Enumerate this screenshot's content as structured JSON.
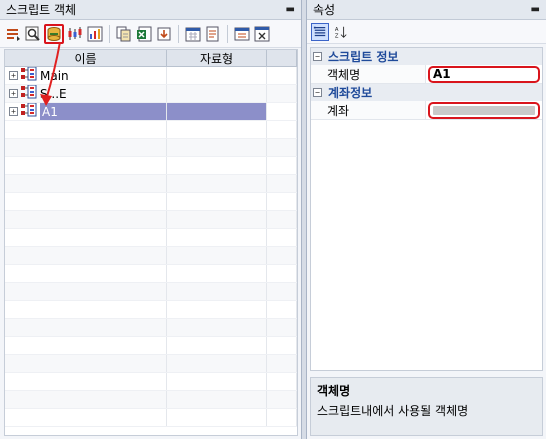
{
  "script_panel": {
    "title": "스크립트 객체",
    "pin": "ᚚ",
    "columns": [
      "이름",
      "자료형"
    ],
    "rows": [
      {
        "name": "Main",
        "type": ""
      },
      {
        "name": "S...E",
        "type": ""
      },
      {
        "name": "A1",
        "type": "",
        "selected": true
      }
    ]
  },
  "toolbar_icons": [
    "open-icon",
    "search-icon",
    "add-object-icon",
    "candles-icon",
    "chart-export-icon",
    "copy-icon",
    "excel-icon",
    "import-icon",
    "calendar-icon",
    "refresh-icon",
    "grid-icon",
    "delete-icon"
  ],
  "properties_panel": {
    "title": "속성",
    "pin": "ᚚ",
    "categories": [
      {
        "label": "스크립트 정보",
        "items": [
          {
            "name": "객체명",
            "value": "A1"
          }
        ]
      },
      {
        "label": "계좌정보",
        "items": [
          {
            "name": "계좌",
            "value": ""
          }
        ]
      }
    ],
    "description": {
      "title": "객체명",
      "text": "스크립트내에서 사용될 객체명"
    }
  },
  "colors": {
    "highlight_red": "#d9141c",
    "selected_row": "#8c8fc9",
    "category_text": "#1f4a9a"
  }
}
